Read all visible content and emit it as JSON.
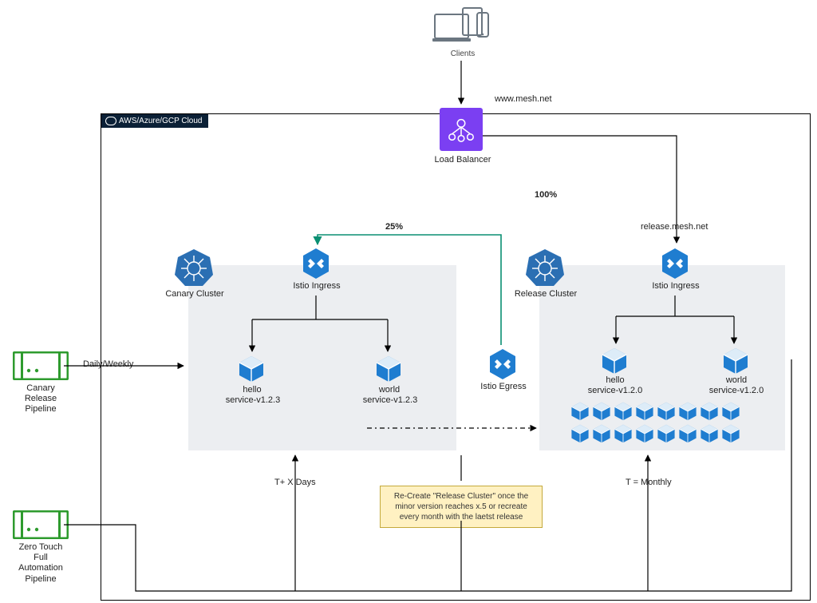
{
  "clients_label": "Clients",
  "url_top": "www.mesh.net",
  "cloud_title": "AWS/Azure/GCP Cloud",
  "load_balancer_label": "Load Balancer",
  "edge_100": "100%",
  "edge_25": "25%",
  "release_url": "release.mesh.net",
  "canary": {
    "cluster_label": "Canary Cluster",
    "ingress_label": "Istio Ingress",
    "svc1_name": "hello",
    "svc1_ver": "service-v1.2.3",
    "svc2_name": "world",
    "svc2_ver": "service-v1.2.3",
    "schedule": "T+ X Days",
    "egress_label": "Istio Egress"
  },
  "release": {
    "cluster_label": "Release Cluster",
    "ingress_label": "Istio Ingress",
    "svc1_name": "hello",
    "svc1_ver": "service-v1.2.0",
    "svc2_name": "world",
    "svc2_ver": "service-v1.2.0",
    "schedule": "T = Monthly"
  },
  "note": "Re-Create \"Release Cluster\" once the minor version reaches x.5 or recreate every month with the laetst release",
  "pipelines": {
    "canary_label": "Canary\nRelease\nPipeline",
    "canary_edge": "Daily/Weekly",
    "zero_label": "Zero Touch\nFull\nAutomation\nPipeline"
  }
}
